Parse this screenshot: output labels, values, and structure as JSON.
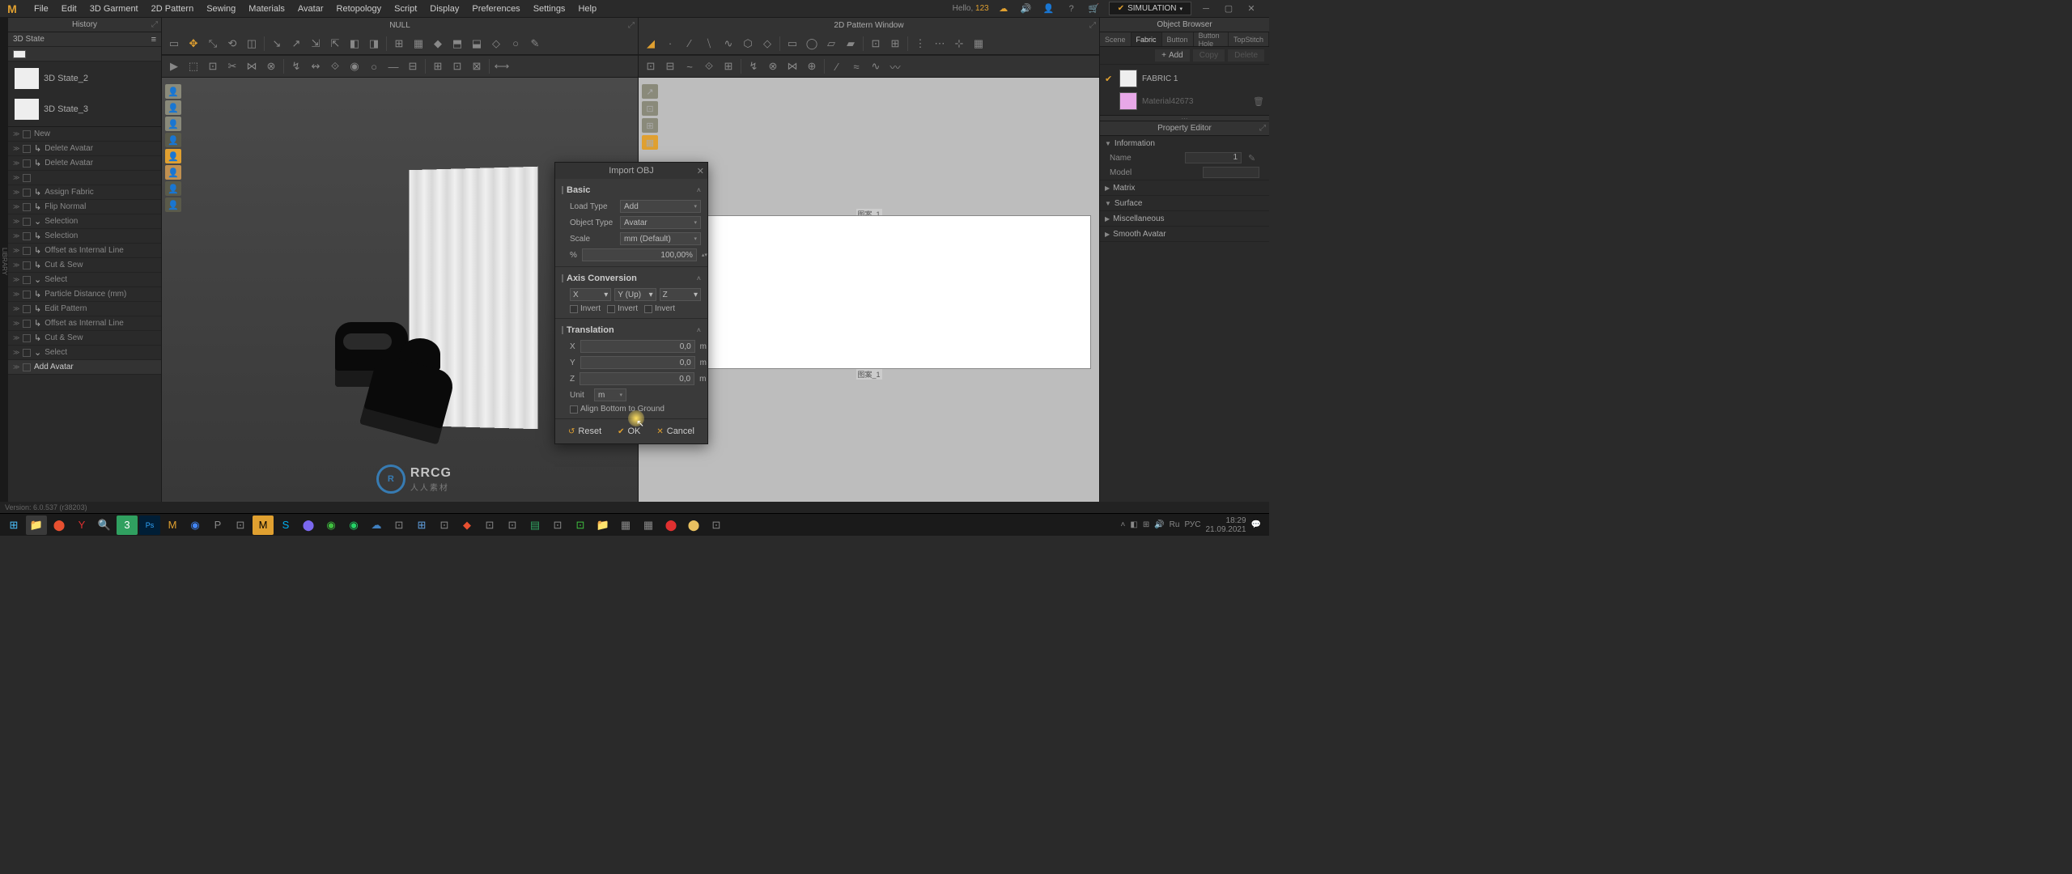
{
  "menubar": {
    "items": [
      "File",
      "Edit",
      "3D Garment",
      "2D Pattern",
      "Sewing",
      "Materials",
      "Avatar",
      "Retopology",
      "Script",
      "Display",
      "Preferences",
      "Settings",
      "Help"
    ],
    "hello": "Hello,",
    "hello_value": "123",
    "sim_label": "SIMULATION"
  },
  "left": {
    "history_title": "History",
    "state_label": "3D State",
    "states": [
      {
        "label": "3D State_2"
      },
      {
        "label": "3D State_3"
      }
    ],
    "history": [
      "New",
      "Delete Avatar",
      "Delete Avatar",
      "",
      "Assign Fabric",
      "Flip Normal",
      "Selection",
      "Selection",
      "Offset as Internal Line",
      "Cut & Sew",
      "Select",
      "Particle Distance (mm)",
      "Edit Pattern",
      "Offset as Internal Line",
      "Cut & Sew",
      "Select",
      "Add Avatar"
    ]
  },
  "viewport3d": {
    "title": "NULL"
  },
  "viewport2d": {
    "title": "2D Pattern Window",
    "pattern_top": "图案_1",
    "pattern_bot": "图案_1"
  },
  "right": {
    "browser_title": "Object Browser",
    "tabs": [
      "Scene",
      "Fabric",
      "Button",
      "Button Hole",
      "TopStitch"
    ],
    "active_tab": 1,
    "add_label": "Add",
    "copy_label": "Copy",
    "del_label": "Delete",
    "fabrics": [
      {
        "name": "FABRIC 1",
        "color": "white",
        "checked": true
      },
      {
        "name": "Material42673",
        "color": "pink",
        "checked": false
      }
    ],
    "prop_title": "Property Editor",
    "sections": {
      "information": "Information",
      "name_label": "Name",
      "name_value": "1",
      "model_label": "Model",
      "matrix": "Matrix",
      "surface": "Surface",
      "misc": "Miscellaneous",
      "smooth": "Smooth Avatar"
    }
  },
  "dialog": {
    "title": "Import OBJ",
    "basic": "Basic",
    "load_type_label": "Load Type",
    "load_type_value": "Add",
    "object_type_label": "Object Type",
    "object_type_value": "Avatar",
    "scale_label": "Scale",
    "scale_value": "mm (Default)",
    "percent_label": "%",
    "percent_value": "100,00%",
    "axis_conversion": "Axis Conversion",
    "axis_x": "X",
    "axis_y": "Y (Up)",
    "axis_z": "Z",
    "invert": "Invert",
    "translation": "Translation",
    "tx_label": "X",
    "tx_value": "0,0",
    "ty_label": "Y",
    "ty_value": "0,0",
    "tz_label": "Z",
    "tz_value": "0,0",
    "unit_label": "Unit",
    "unit_value": "m",
    "m_unit": "m",
    "align_label": "Align Bottom to Ground",
    "reset": "Reset",
    "ok": "OK",
    "cancel": "Cancel"
  },
  "watermark": {
    "brand": "RRCG",
    "sub": "人人素材"
  },
  "footer": {
    "version": "Version: 6.0.537 (r38203)",
    "tray": {
      "lang1": "Ru",
      "lang2": "РУС",
      "time": "18:29",
      "date": "21.09.2021"
    }
  }
}
